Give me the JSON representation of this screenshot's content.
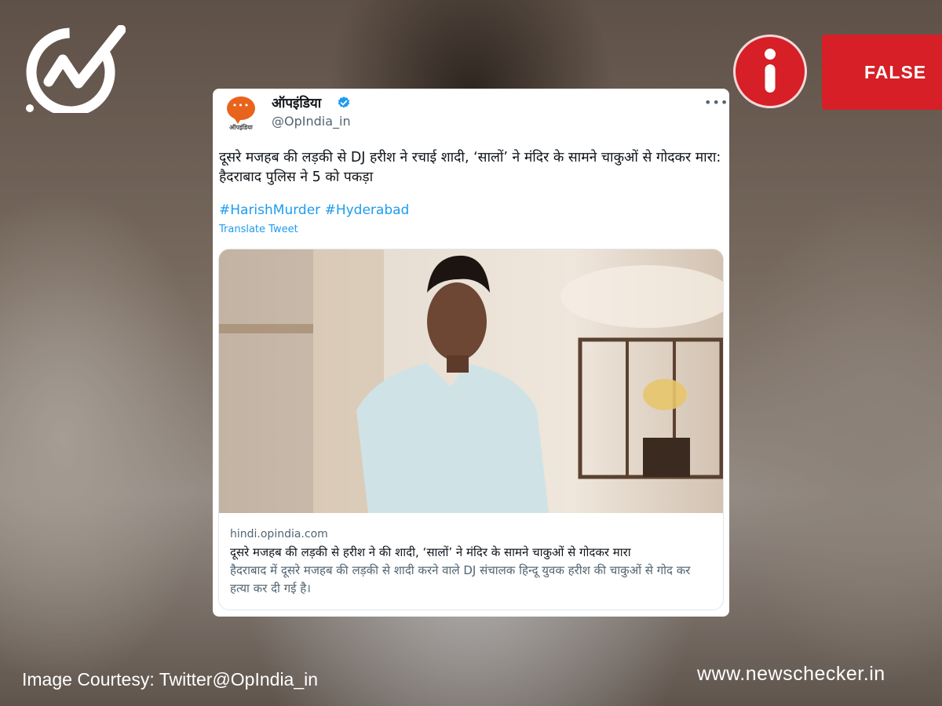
{
  "brand": {
    "logo_icon": "newschecker-check-icon",
    "site_url": "www.newschecker.in",
    "credit": "Image Courtesy: Twitter@OpIndia_in"
  },
  "verdict": {
    "icon": "info-icon",
    "label": "FALSE",
    "color": "#d61f26"
  },
  "tweet": {
    "avatar_text": "ऑपइंडिया",
    "display_name": "ऑपइंडिया",
    "verified_icon": "verified-badge-icon",
    "handle": "@OpIndia_in",
    "more_icon": "more-options-icon",
    "text": "दूसरे मजहब की लड़की से DJ हरीश ने रचाई शादी, ‘सालों’ ने मंदिर के सामने चाकुओं से गोदकर मारा: हैदराबाद पुलिस ने 5 को पकड़ा",
    "hashtags": [
      "#HarishMurder",
      "#Hyderabad"
    ],
    "translate_label": "Translate Tweet",
    "link_card": {
      "domain": "hindi.opindia.com",
      "title": "दूसरे मजहब की लड़की से हरीश ने की शादी, ‘सालों’ ने मंदिर के सामने चाकुओं से गोदकर मारा",
      "description": "हैदराबाद में दूसरे मजहब की लड़की से शादी करने वाले DJ संचालक हिन्दू युवक हरीश की चाकुओं से गोद कर हत्या कर दी गई है।"
    }
  }
}
